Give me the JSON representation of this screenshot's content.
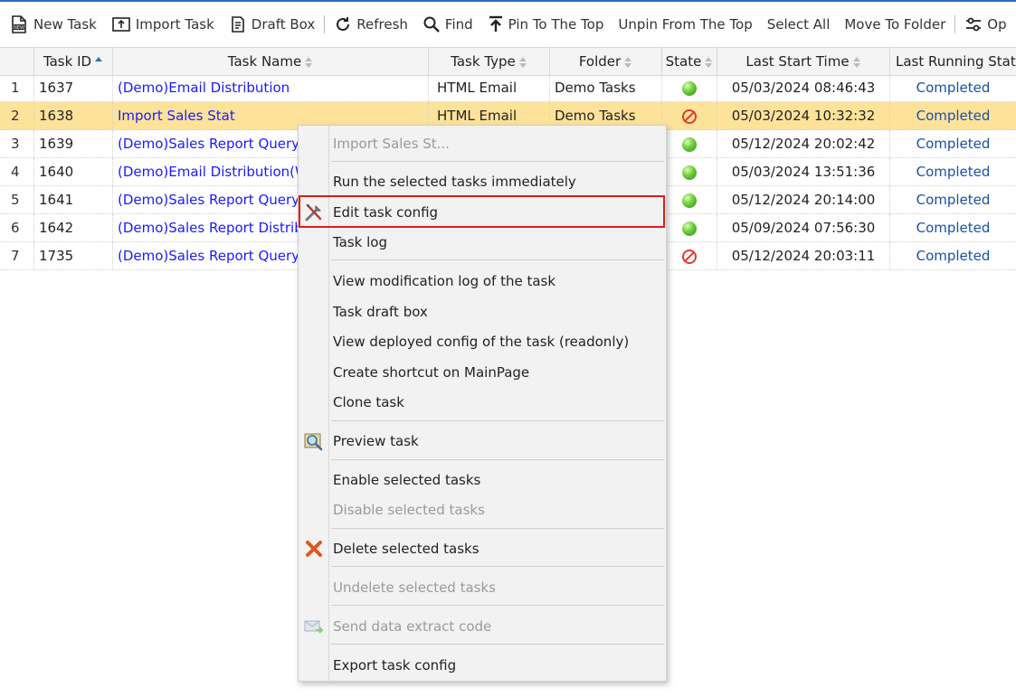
{
  "toolbar": {
    "new_task": "New Task",
    "import_task": "Import Task",
    "draft_box": "Draft Box",
    "refresh": "Refresh",
    "find": "Find",
    "pin_top": "Pin To The Top",
    "unpin_top": "Unpin From The Top",
    "select_all": "Select All",
    "move_folder": "Move To Folder",
    "options": "Op"
  },
  "columns": {
    "task_id": "Task ID",
    "task_name": "Task Name",
    "task_type": "Task Type",
    "folder": "Folder",
    "state": "State",
    "last_start": "Last Start Time",
    "last_status": "Last Running State"
  },
  "rows": [
    {
      "num": "1",
      "id": "1637",
      "name": "(Demo)Email Distribution",
      "type": "HTML Email",
      "folder": "Demo Tasks",
      "state": "enabled",
      "time": "05/03/2024 08:46:43",
      "status": "Completed"
    },
    {
      "num": "2",
      "id": "1638",
      "name": "Import Sales Stat",
      "type": "HTML Email",
      "folder": "Demo Tasks",
      "state": "disabled",
      "time": "05/03/2024 10:32:32",
      "status": "Completed"
    },
    {
      "num": "3",
      "id": "1639",
      "name": "(Demo)Sales Report Query",
      "type": "",
      "folder": "",
      "state": "enabled",
      "time": "05/12/2024 20:02:42",
      "status": "Completed"
    },
    {
      "num": "4",
      "id": "1640",
      "name": "(Demo)Email Distribution(W",
      "type": "",
      "folder": "",
      "state": "enabled",
      "time": "05/03/2024 13:51:36",
      "status": "Completed"
    },
    {
      "num": "5",
      "id": "1641",
      "name": "(Demo)Sales Report Query(",
      "type": "",
      "folder": "",
      "state": "enabled",
      "time": "05/12/2024 20:14:00",
      "status": "Completed"
    },
    {
      "num": "6",
      "id": "1642",
      "name": "(Demo)Sales Report Distrib",
      "type": "",
      "folder": "",
      "state": "enabled",
      "time": "05/09/2024 07:56:30",
      "status": "Completed"
    },
    {
      "num": "7",
      "id": "1735",
      "name": "(Demo)Sales Report Query(",
      "type": "",
      "folder": "",
      "state": "disabled",
      "time": "05/12/2024 20:03:11",
      "status": "Completed"
    }
  ],
  "menu": {
    "title": "Import Sales St...",
    "run_now": "Run the selected tasks immediately",
    "edit_config": "Edit task config",
    "task_log": "Task log",
    "view_mod_log": "View modification log of the task",
    "draft_box": "Task draft box",
    "view_deployed": "View deployed config of the task (readonly)",
    "create_shortcut": "Create shortcut on MainPage",
    "clone": "Clone task",
    "preview": "Preview task",
    "enable": "Enable selected tasks",
    "disable": "Disable selected tasks",
    "delete": "Delete selected tasks",
    "undelete": "Undelete selected tasks",
    "send_code": "Send data extract code",
    "export": "Export task config"
  },
  "colors": {
    "selected_row": "#fde39a",
    "link": "#1a1aff",
    "status": "#1a4fa8",
    "highlight_box": "#e21b1b"
  }
}
